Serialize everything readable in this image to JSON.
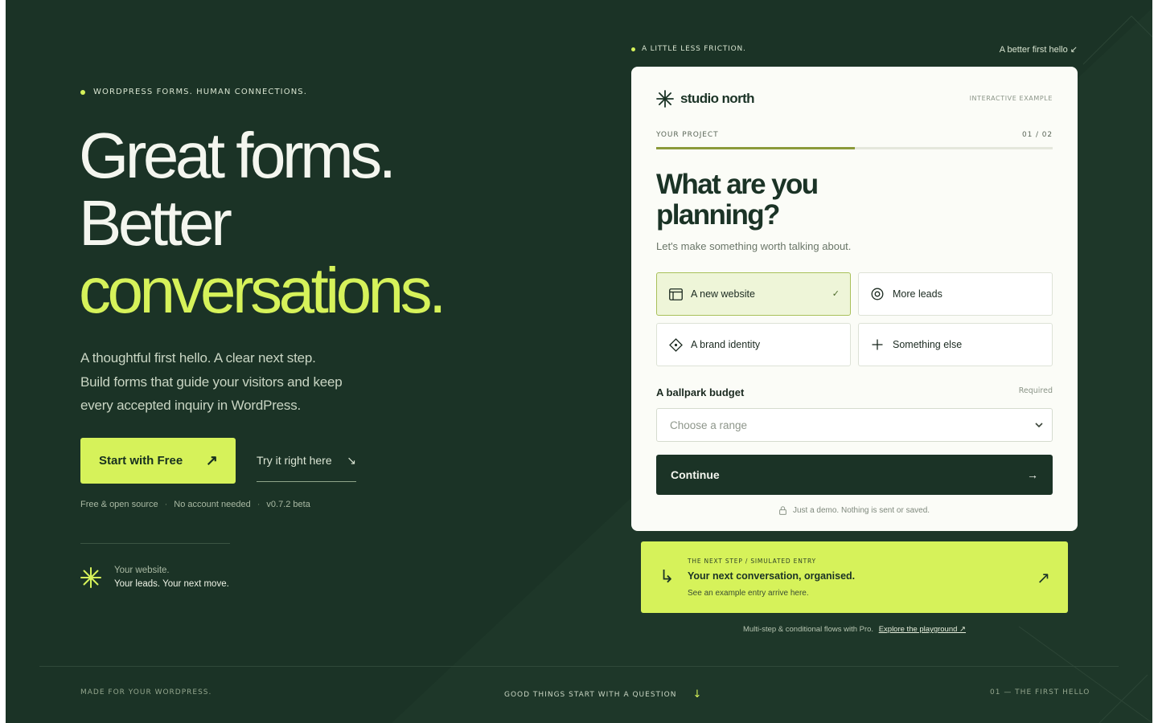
{
  "hero": {
    "eyebrow": "WORDPRESS FORMS. HUMAN CONNECTIONS.",
    "headline_line1": "Great forms.",
    "headline_line2": "Better",
    "headline_line3": "conversations.",
    "lede_line1": "A thoughtful first hello. A clear next step.",
    "lede_line2": "Build forms that guide your visitors and keep",
    "lede_line3": "every accepted inquiry in WordPress.",
    "cta_primary": "Start with Free",
    "cta_primary_icon": "↗",
    "cta_secondary": "Try it right here",
    "cta_secondary_icon": "↘",
    "meta": [
      "Free & open source",
      "No account needed",
      "v0.7.2 beta"
    ],
    "meta_sep": "·",
    "tag_line1": "Your website.",
    "tag_line2": "Your leads. Your next move."
  },
  "demo": {
    "eyebrow": "A LITTLE LESS FRICTION.",
    "note": "A better first hello ↙",
    "brand_name": "studio north",
    "interactive_tag": "INTERACTIVE EXAMPLE",
    "step_label": "YOUR PROJECT",
    "step_count": "01 / 02",
    "progress": 0.5,
    "question_line1": "What are you",
    "question_line2": "planning?",
    "question_sub": "Let's make something worth talking about.",
    "options": [
      {
        "label": "A new website",
        "icon": "browser-icon",
        "selected": true
      },
      {
        "label": "More leads",
        "icon": "target-icon",
        "selected": false
      },
      {
        "label": "A brand identity",
        "icon": "diamond-icon",
        "selected": false
      },
      {
        "label": "Something else",
        "icon": "plus-icon",
        "selected": false
      }
    ],
    "selected_check": "✓",
    "budget_label": "A ballpark budget",
    "required_label": "Required",
    "budget_placeholder": "Choose a range",
    "continue_label": "Continue",
    "continue_icon": "→",
    "demo_note": "Just a demo. Nothing is sent or saved."
  },
  "next_step": {
    "eyebrow": "THE NEXT STEP / SIMULATED ENTRY",
    "title": "Your next conversation, organised.",
    "subtitle": "See an example entry arrive here.",
    "icon": "↳",
    "arrow": "↗"
  },
  "pro_note": {
    "text": "Multi-step & conditional flows with Pro.",
    "link": "Explore the playground ↗"
  },
  "footer": {
    "left": "MADE FOR YOUR WORDPRESS.",
    "middle": "GOOD THINGS START WITH A QUESTION",
    "middle_icon": "↓",
    "right": "01 — THE FIRST HELLO"
  },
  "colors": {
    "background": "#1b3326",
    "accent": "#d6f25a",
    "card": "#fbfcf7"
  }
}
